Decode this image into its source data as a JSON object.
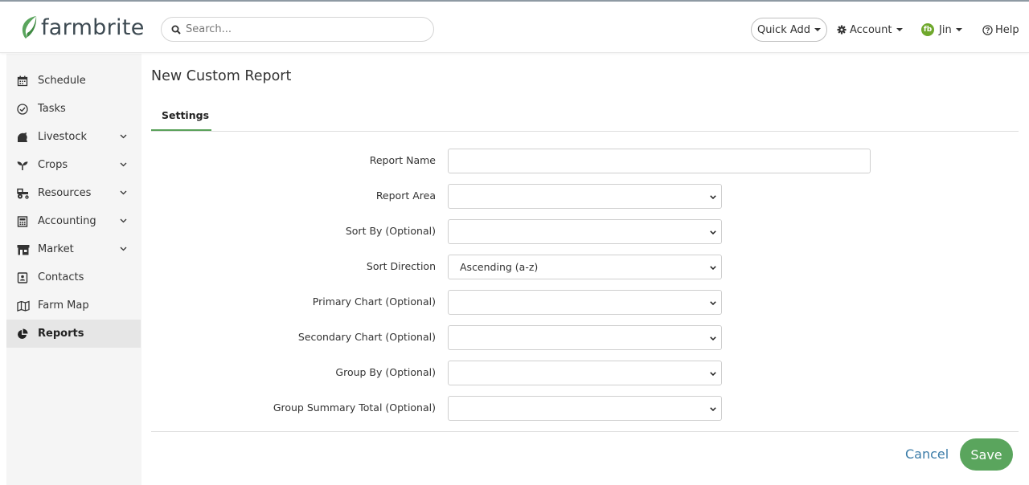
{
  "brand": {
    "name": "farmbrite",
    "accent": "#5aa55d",
    "link": "#3b7ca8"
  },
  "header": {
    "search_placeholder": "Search...",
    "quick_add": "Quick Add",
    "account": "Account",
    "user_initials": "fb",
    "user": "Jin",
    "help": "Help"
  },
  "sidebar": {
    "items": [
      {
        "label": "Schedule",
        "icon": "calendar-icon"
      },
      {
        "label": "Tasks",
        "icon": "check-circle-icon"
      },
      {
        "label": "Livestock",
        "icon": "livestock-icon",
        "expandable": true
      },
      {
        "label": "Crops",
        "icon": "sprout-icon",
        "expandable": true
      },
      {
        "label": "Resources",
        "icon": "tractor-icon",
        "expandable": true
      },
      {
        "label": "Accounting",
        "icon": "calculator-icon",
        "expandable": true
      },
      {
        "label": "Market",
        "icon": "store-icon",
        "expandable": true
      },
      {
        "label": "Contacts",
        "icon": "contact-card-icon"
      },
      {
        "label": "Farm Map",
        "icon": "map-icon"
      },
      {
        "label": "Reports",
        "icon": "pie-chart-icon",
        "active": true
      }
    ]
  },
  "main": {
    "title": "New Custom Report",
    "tab": "Settings",
    "form": {
      "report_name": {
        "label": "Report Name",
        "value": ""
      },
      "report_area": {
        "label": "Report Area",
        "value": ""
      },
      "sort_by": {
        "label": "Sort By (Optional)",
        "value": ""
      },
      "sort_direction": {
        "label": "Sort Direction",
        "value": "Ascending (a-z)"
      },
      "primary_chart": {
        "label": "Primary Chart (Optional)",
        "value": ""
      },
      "secondary_chart": {
        "label": "Secondary Chart (Optional)",
        "value": ""
      },
      "group_by": {
        "label": "Group By (Optional)",
        "value": ""
      },
      "group_summary_total": {
        "label": "Group Summary Total (Optional)",
        "value": ""
      }
    },
    "cancel": "Cancel",
    "save": "Save"
  }
}
